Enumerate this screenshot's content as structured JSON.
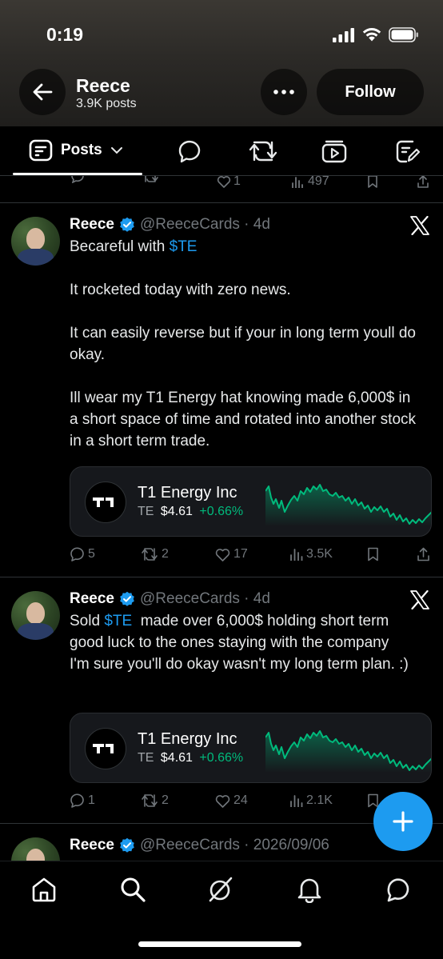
{
  "status_bar": {
    "time": "0:19"
  },
  "profile": {
    "name": "Reece",
    "posts_count": "3.9K posts",
    "follow_label": "Follow"
  },
  "tabs": {
    "posts_label": "Posts"
  },
  "prev_tweet": {
    "likes": "1",
    "views": "497"
  },
  "tweets": [
    {
      "name": "Reece",
      "handle_time": "@ReeceCards · 4d",
      "body": [
        {
          "prefix": "Becareful with ",
          "cashtag": "$TE",
          "suffix": ""
        },
        {
          "text": "It rocketed today with zero news."
        },
        {
          "text": "It can easily reverse but if your in long term youll do okay."
        },
        {
          "text": "Ill wear my T1 Energy hat knowing made 6,000$ in a short space of time and rotated into another stock in a short term trade."
        }
      ],
      "stock": {
        "name": "T1 Energy Inc",
        "ticker": "TE",
        "price": "$4.61",
        "change": "+0.66%"
      },
      "stats": {
        "replies": "5",
        "reposts": "2",
        "likes": "17",
        "views": "3.5K"
      }
    },
    {
      "name": "Reece",
      "handle_time": "@ReeceCards · 4d",
      "body": [
        {
          "prefix": "Sold ",
          "cashtag": "$TE",
          "suffix": "  made over 6,000$ holding short term good luck to the ones staying with the company I'm sure you'll do okay wasn't my long term plan. :)"
        }
      ],
      "stock": {
        "name": "T1 Energy Inc",
        "ticker": "TE",
        "price": "$4.61",
        "change": "+0.66%"
      },
      "stats": {
        "replies": "1",
        "reposts": "2",
        "likes": "24",
        "views": "2.1K"
      }
    },
    {
      "name": "Reece",
      "handle_time": "@ReeceCards · 2026/09/06"
    }
  ],
  "colors": {
    "accent": "#1d9bf0",
    "positive": "#00ba7c",
    "muted": "#71767b"
  },
  "icons": {
    "tabs": [
      "posts-icon",
      "chevron-down-icon",
      "replies-icon",
      "reposts-icon",
      "media-icon",
      "articles-icon"
    ],
    "nav": [
      "home-icon",
      "search-icon",
      "grok-icon",
      "notifications-icon",
      "messages-icon"
    ],
    "fab": "plus-icon"
  }
}
